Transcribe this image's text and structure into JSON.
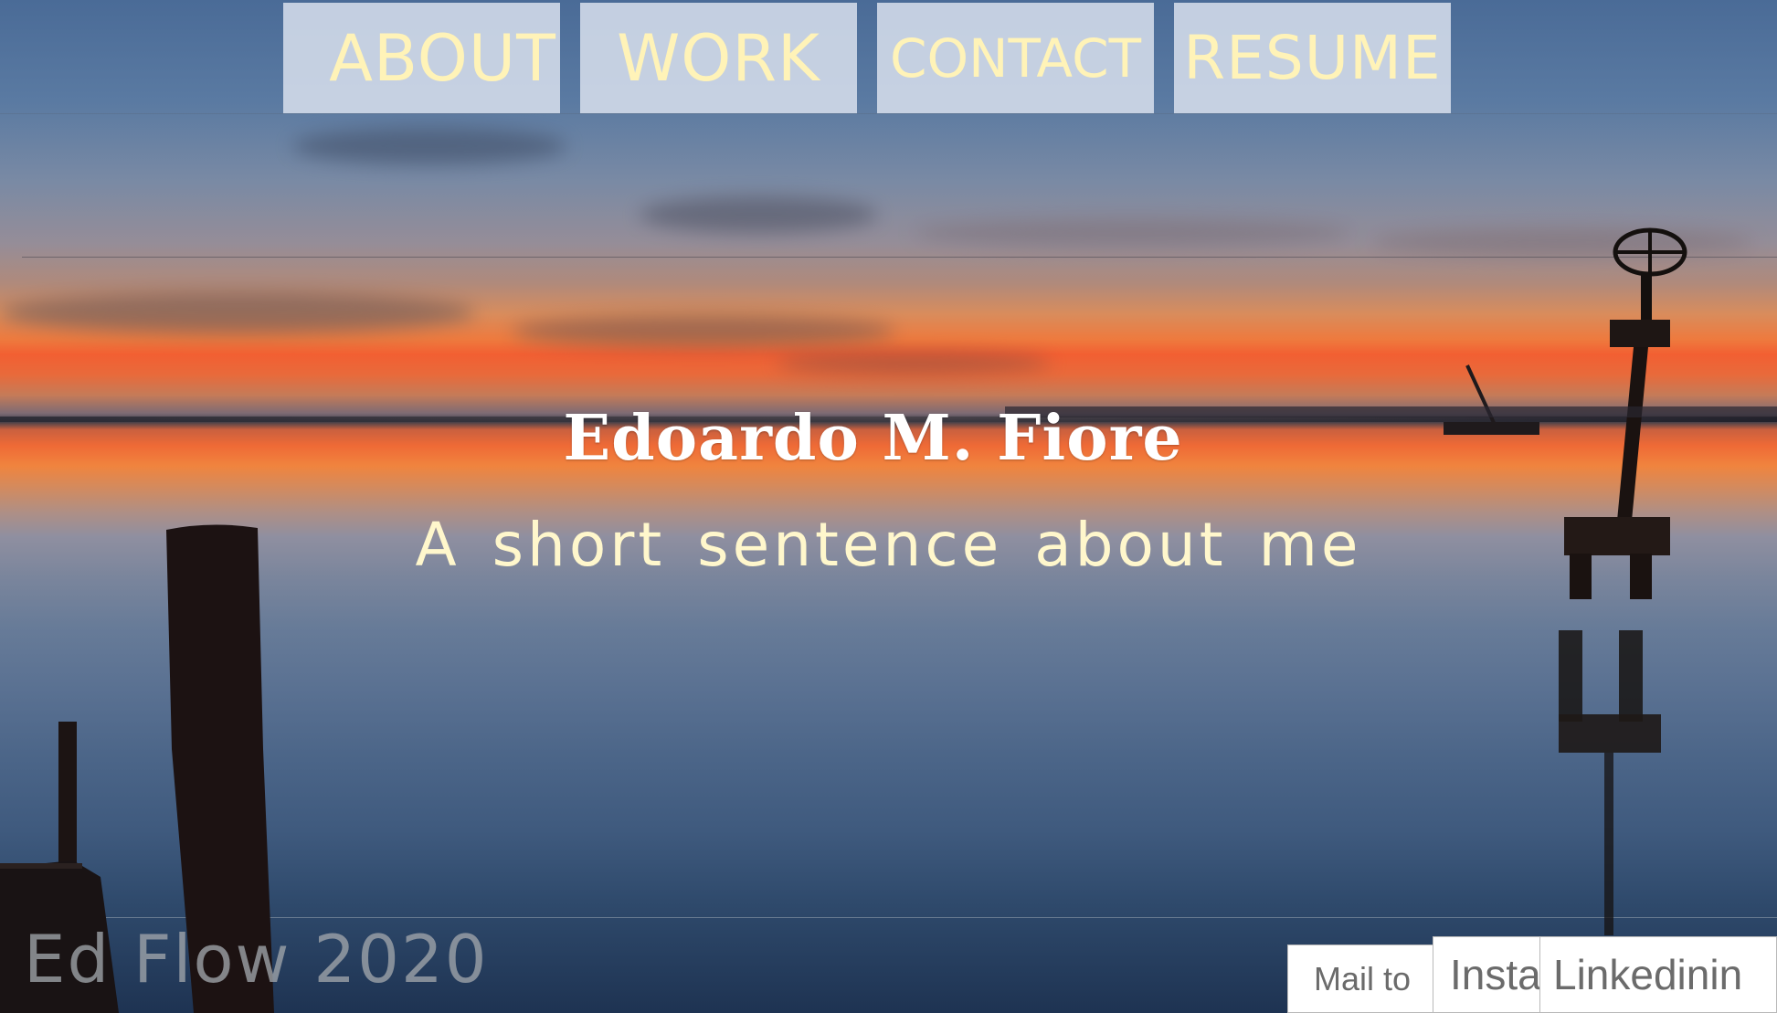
{
  "nav": {
    "items": [
      {
        "label": "ABOUT"
      },
      {
        "label": "WORK"
      },
      {
        "label": "CONTACT"
      },
      {
        "label": "RESUME"
      }
    ]
  },
  "hero": {
    "name": "Edoardo M. Fiore",
    "tagline": "A short sentence about me"
  },
  "footer": {
    "copyright": "Ed Flow 2020",
    "links": {
      "mail": "Mail to",
      "insta": "Insta",
      "linkedin": "Linkedinin"
    }
  },
  "colors": {
    "nav_bg": "#d5ddeb",
    "nav_text": "#fff3b8",
    "name_text": "#ffffff",
    "tagline_text": "#fff7cc",
    "copyright_text": "#a0a5aa",
    "link_text": "#6b6b6b"
  }
}
